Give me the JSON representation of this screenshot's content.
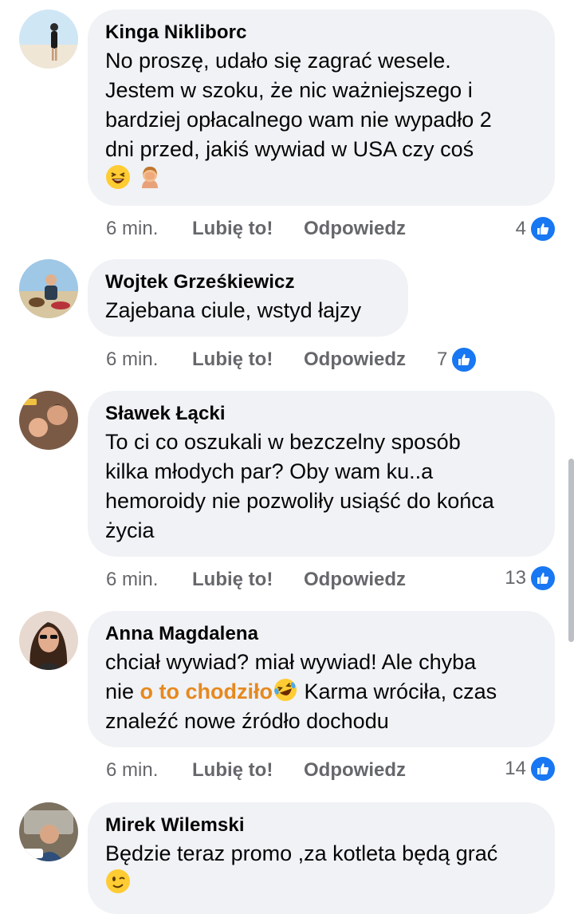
{
  "comments": [
    {
      "name": "Kinga Nikliborc",
      "text_lines": [
        "No proszę, udało się zagrać wesele.",
        "Jestem w szoku, że nic ważniejszego i",
        "bardziej opłacalnego wam nie wypadło 2",
        "dni przed, jakiś wywiad w USA czy coś"
      ],
      "time": "6 min.",
      "like_label": "Lubię to!",
      "reply_label": "Odpowiedz",
      "reaction_count": "4",
      "emojis": [
        "laughing-emoji",
        "facepalm-emoji"
      ]
    },
    {
      "name": "Wojtek Grześkiewicz",
      "text_lines": [
        "Zajebana ciule, wstyd łajzy"
      ],
      "time": "6 min.",
      "like_label": "Lubię to!",
      "reply_label": "Odpowiedz",
      "reaction_count": "7"
    },
    {
      "name": "Sławek Łącki",
      "text_lines": [
        "To ci co oszukali w bezczelny sposób",
        "kilka młodych par? Oby wam ku..a",
        "hemoroidy nie pozwoliły usiąść do końca",
        "życia"
      ],
      "time": "6 min.",
      "like_label": "Lubię to!",
      "reply_label": "Odpowiedz",
      "reaction_count": "13"
    },
    {
      "name": "Anna Magdalena",
      "line1": "chciał wywiad? miał wywiad! Ale chyba",
      "line2_pre": "nie ",
      "line2_highlight": "o to chodziło",
      "line2_post": " Karma wróciła, czas",
      "line3": "znaleźć nowe źródło dochodu",
      "time": "6 min.",
      "like_label": "Lubię to!",
      "reply_label": "Odpowiedz",
      "reaction_count": "14",
      "emojis": [
        "rolling-laughing-emoji"
      ]
    },
    {
      "name": "Mirek Wilemski",
      "text_lines": [
        "Będzie teraz promo ,za kotleta będą grać"
      ],
      "emojis": [
        "winking-emoji"
      ]
    }
  ],
  "colors": {
    "bubble": "#f0f2f5",
    "like_blue": "#1877f2",
    "highlight": "#e6891f",
    "meta": "#65676b"
  }
}
